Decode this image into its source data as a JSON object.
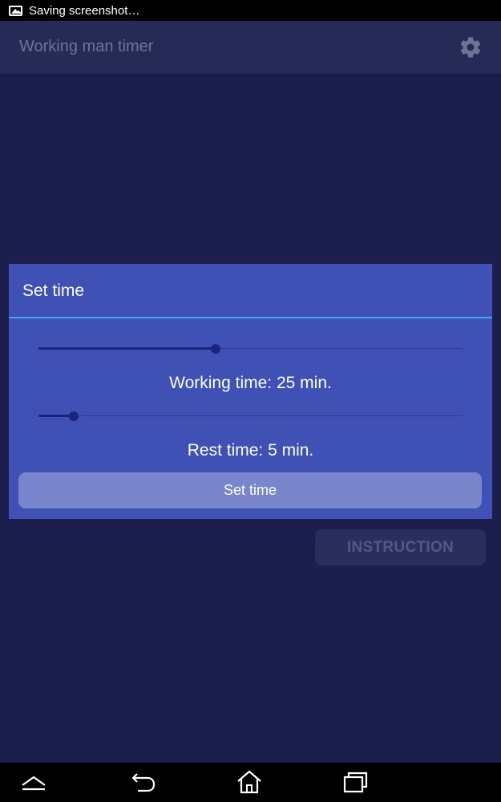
{
  "status_bar": {
    "notification_icon": "image-icon",
    "text": "Saving screenshot…"
  },
  "app_bar": {
    "title": "Working man timer",
    "settings_icon": "gear-icon"
  },
  "dialog": {
    "title": "Set time",
    "working_slider": {
      "value": 25,
      "fraction": 0.417
    },
    "working_label": "Working time: 25 min.",
    "rest_slider": {
      "value": 5,
      "fraction": 0.083
    },
    "rest_label": "Rest time: 5 min.",
    "set_time_button": "Set time"
  },
  "instruction_button": "INSTRUCTION",
  "nav_bar": {
    "icons": [
      "chevron-up-icon",
      "back-icon",
      "home-icon",
      "recent-apps-icon"
    ]
  },
  "colors": {
    "background": "#1c1f4e",
    "app_bar": "#262a56",
    "dialog": "#3f51b5",
    "accent_divider": "#42a5f5",
    "slider_thumb": "#1a237e",
    "button": "#7986cb"
  }
}
